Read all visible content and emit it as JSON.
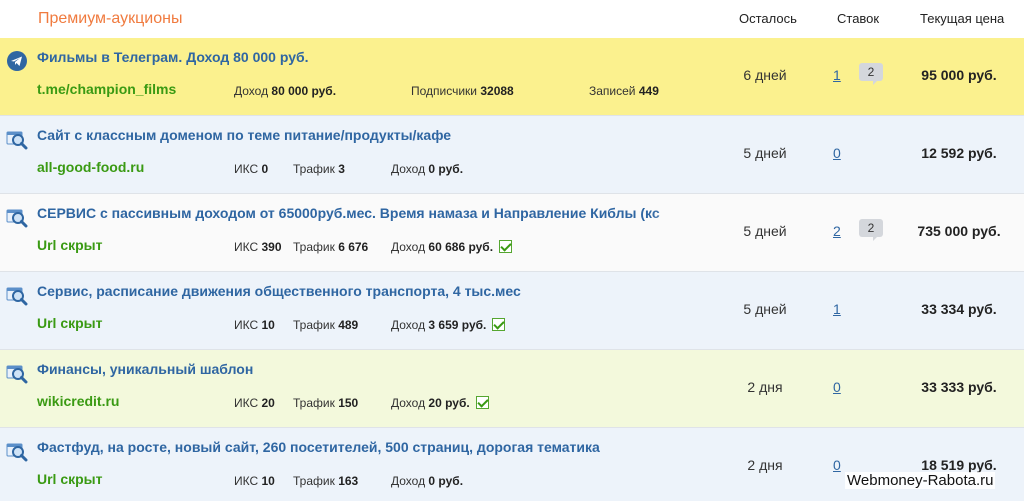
{
  "header": {
    "title": "Премиум-аукционы",
    "col_left": "Осталось",
    "col_bids": "Ставок",
    "col_price": "Текущая цена"
  },
  "rows": [
    {
      "icon": "telegram-icon",
      "title": "Фильмы в Телеграм. Доход 80 000 руб.",
      "url": "t.me/champion_films",
      "m1_label": "Доход",
      "m1_value": "80 000 руб.",
      "m2_label": "Подписчики",
      "m2_value": "32088",
      "m3_label": "Записей",
      "m3_value": "449",
      "days": "6 дней",
      "bids": "1",
      "comments": "2",
      "price": "95 000 руб."
    },
    {
      "icon": "site-search-icon",
      "title": "Сайт с классным доменом по теме питание/продукты/кафе",
      "url": "all-good-food.ru",
      "iks_label": "ИКС",
      "iks_value": "0",
      "traffic_label": "Трафик",
      "traffic_value": "3",
      "income_label": "Доход",
      "income_value": "0 руб.",
      "days": "5 дней",
      "bids": "0",
      "price": "12 592 руб."
    },
    {
      "icon": "site-search-icon",
      "title": "СЕРВИС с пассивным доходом от 65000руб.мес. Время намаза и Направление Киблы (кс",
      "url": "Url скрыт",
      "iks_label": "ИКС",
      "iks_value": "390",
      "traffic_label": "Трафик",
      "traffic_value": "6 676",
      "income_label": "Доход",
      "income_value": "60 686 руб.",
      "days": "5 дней",
      "bids": "2",
      "comments": "2",
      "price": "735 000 руб."
    },
    {
      "icon": "site-search-icon",
      "title": "Сервис, расписание движения общественного транспорта, 4 тыс.мес",
      "url": "Url скрыт",
      "iks_label": "ИКС",
      "iks_value": "10",
      "traffic_label": "Трафик",
      "traffic_value": "489",
      "income_label": "Доход",
      "income_value": "3 659 руб.",
      "days": "5 дней",
      "bids": "1",
      "price": "33 334 руб."
    },
    {
      "icon": "site-search-icon",
      "title": "Финансы, уникальный шаблон",
      "url": "wikicredit.ru",
      "iks_label": "ИКС",
      "iks_value": "20",
      "traffic_label": "Трафик",
      "traffic_value": "150",
      "income_label": "Доход",
      "income_value": "20 руб.",
      "days": "2 дня",
      "bids": "0",
      "price": "33 333 руб."
    },
    {
      "icon": "site-search-icon",
      "title": "Фастфуд, на росте, новый сайт, 260 посетителей, 500 страниц, дорогая тематика",
      "url": "Url скрыт",
      "iks_label": "ИКС",
      "iks_value": "10",
      "traffic_label": "Трафик",
      "traffic_value": "163",
      "income_label": "Доход",
      "income_value": "0 руб.",
      "days": "2 дня",
      "bids": "0",
      "price": "18 519 руб."
    }
  ],
  "watermark": "Webmoney-Rabota.ru",
  "colors": {
    "title_orange": "#f07b3f",
    "link_blue": "#2f66a2",
    "url_green": "#3a9a13",
    "row_yellow": "#fbf18e",
    "row_blue": "#edf3fa",
    "row_green": "#f3f9dc"
  }
}
